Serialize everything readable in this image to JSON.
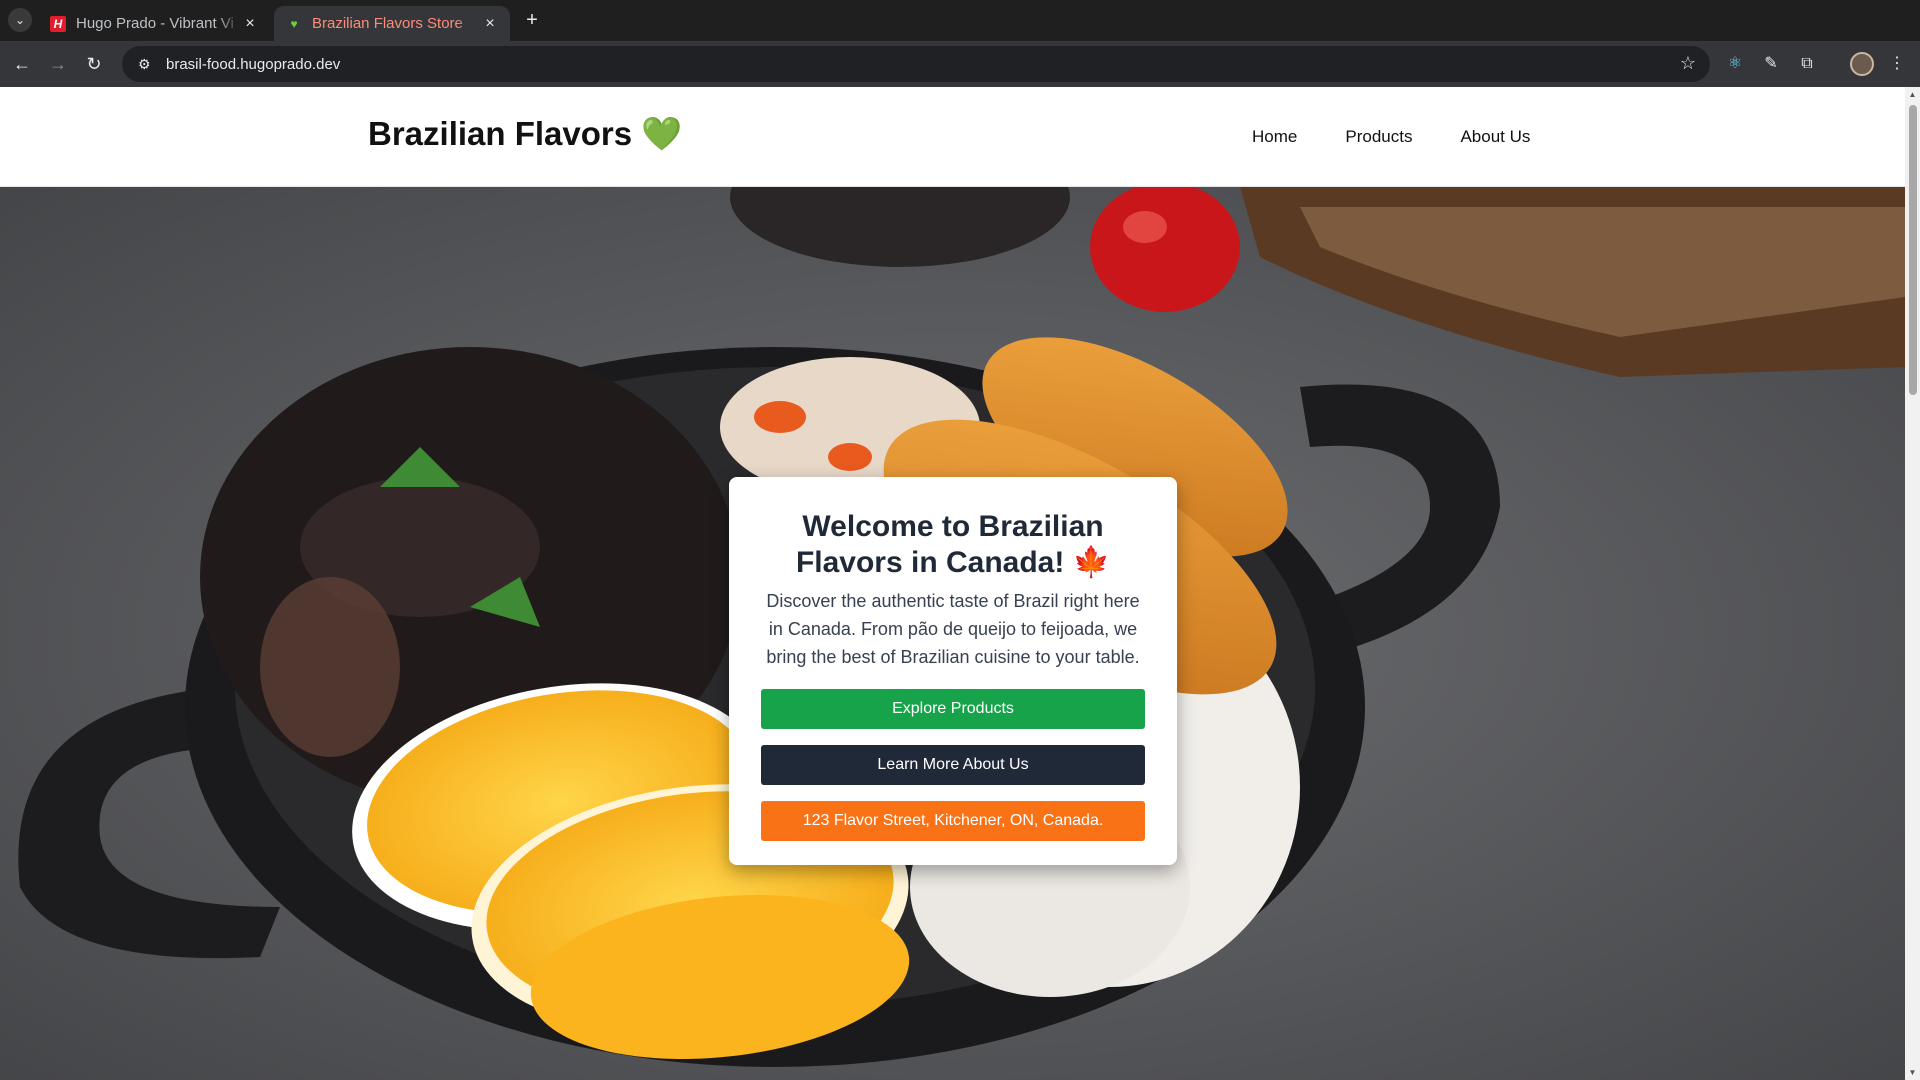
{
  "browser": {
    "tabs": [
      {
        "title": "Hugo Prado - Vibrant Vi",
        "favicon": "h-logo-icon",
        "active": false
      },
      {
        "title": "Brazilian Flavors Store",
        "favicon": "green-heart-icon",
        "active": true
      }
    ],
    "url": "brasil-food.hugoprado.dev"
  },
  "site": {
    "brand": "Brazilian Flavors 💚",
    "nav": [
      "Home",
      "Products",
      "About Us"
    ]
  },
  "hero_card": {
    "title": "Welcome to Brazilian Flavors in Canada! 🍁",
    "description": "Discover the authentic taste of Brazil right here in Canada. From pão de queijo to feijoada, we bring the best of Brazilian cuisine to your table.",
    "buttons": {
      "explore": "Explore Products",
      "about": "Learn More About Us",
      "address": "123 Flavor Street, Kitchener, ON, Canada."
    }
  },
  "colors": {
    "accent_green": "#16a34a",
    "dark_button": "#1f2937",
    "orange_button": "#f97316",
    "active_tab_text": "#ff8a7a"
  }
}
